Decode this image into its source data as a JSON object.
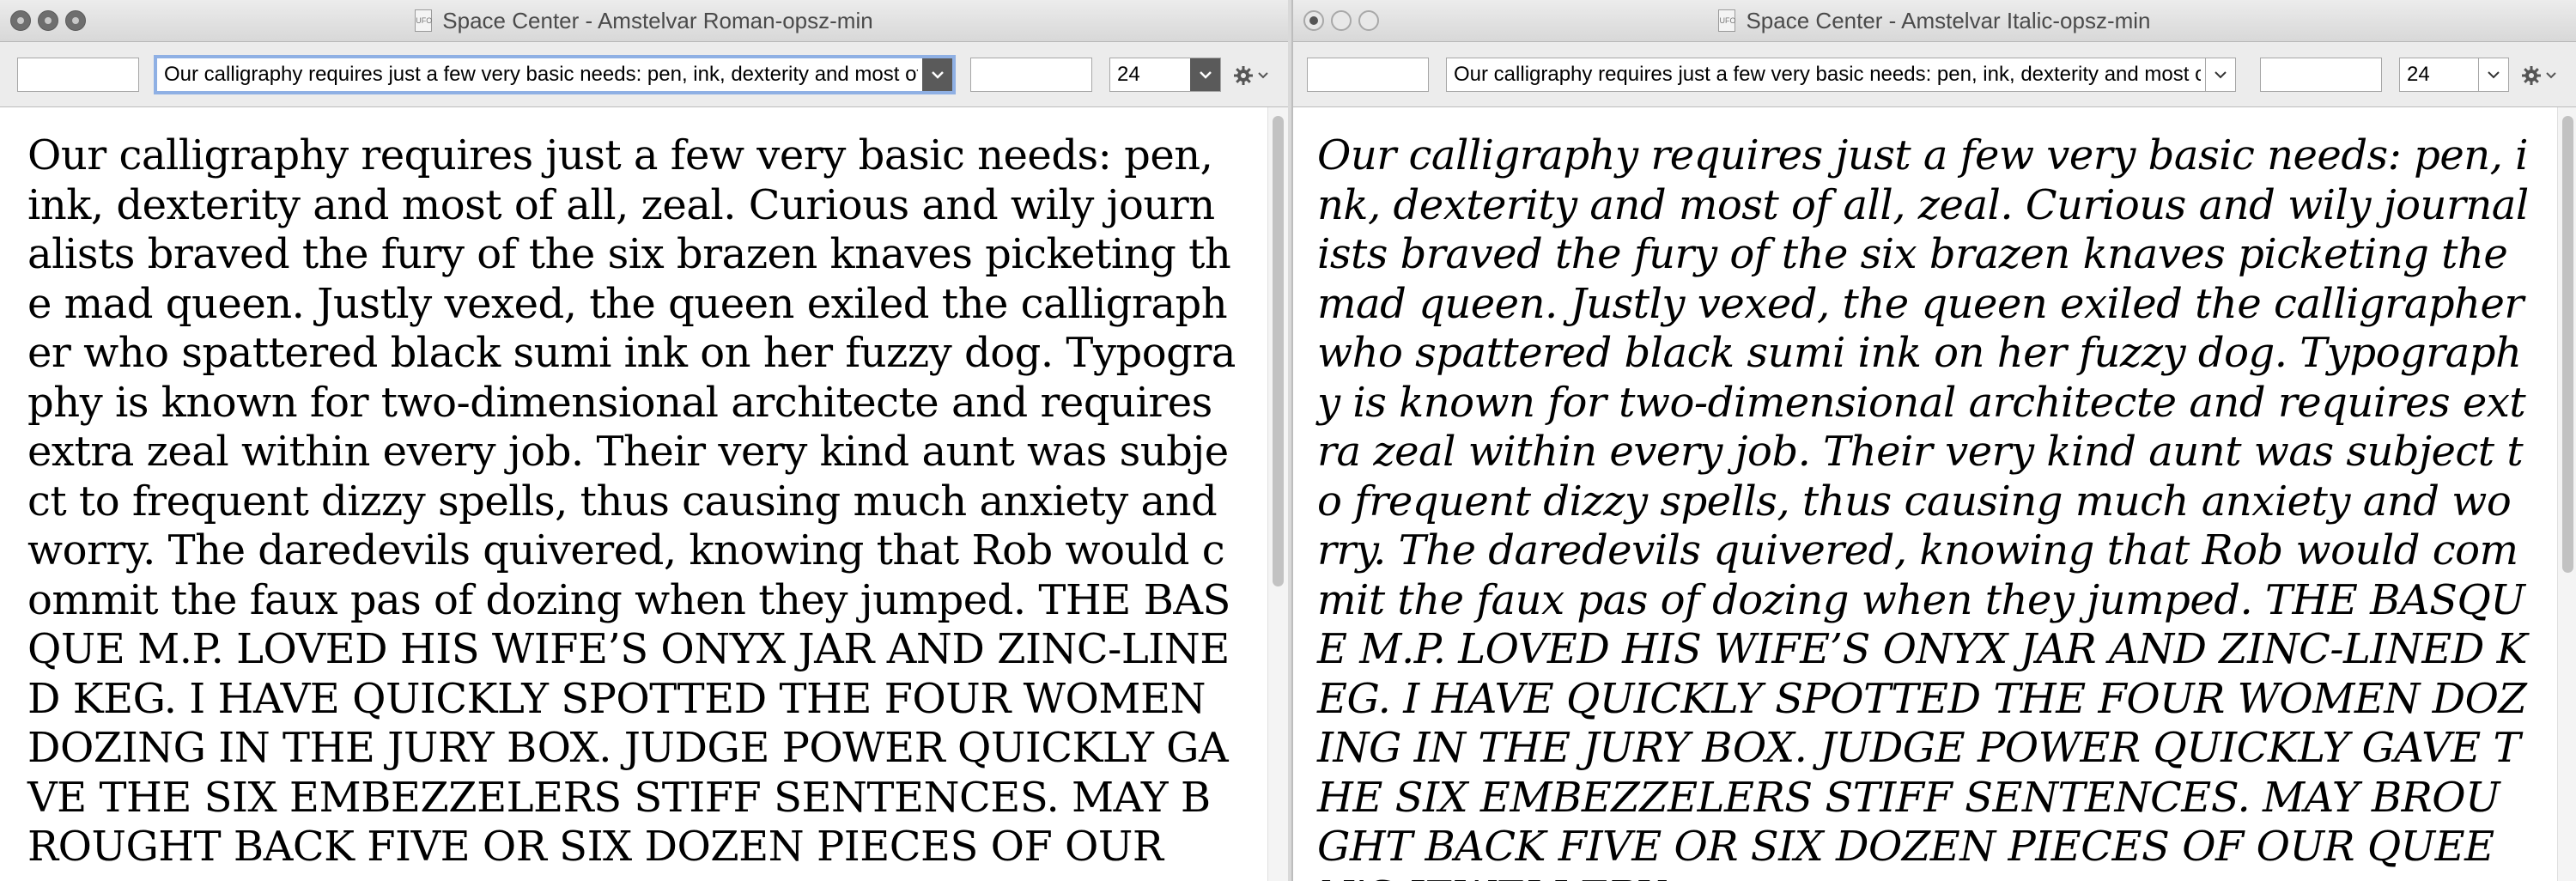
{
  "windows": [
    {
      "title": "Space Center - Amstelvar Roman-opsz-min",
      "doc_icon": "UFO",
      "toolbar": {
        "glyph_field_before": "",
        "sample_text": "Our calligraphy requires just a few very basic needs: pen, ink, dexterity and most of all, zeal.",
        "glyph_field_after": "",
        "point_size": "24"
      },
      "body_text": "Our calligraphy requires just a few very basic needs: pen, ink, dexterity and most of all, zeal. Curious and wily journalists braved the fury of the six brazen knaves picketing the mad queen. Justly vexed, the queen exiled the calligrapher who spattered black sumi ink on her fuzzy dog. Typography is known for two-dimensional architecte and requires extra zeal within every job. Their very kind aunt was subject to frequent dizzy spells, thus causing much anxiety and worry. The daredevils quivered, knowing that Rob would commit the faux pas of dozing when they jumped. THE BASQUE M.P. LOVED HIS WIFE’S ONYX JAR AND ZINC-LINED KEG. I HAVE QUICKLY SPOTTED THE FOUR WOMEN DOZING IN THE JURY BOX. JUDGE POWER QUICKLY GAVE THE SIX EMBEZZELERS STIFF SENTENCES. MAY BROUGHT BACK FIVE OR SIX DOZEN PIECES OF OUR"
    },
    {
      "title": "Space Center - Amstelvar Italic-opsz-min",
      "doc_icon": "UFO",
      "toolbar": {
        "glyph_field_before": "",
        "sample_text": "Our calligraphy requires just a few very basic needs: pen, ink, dexterity and most of all, zeal.",
        "glyph_field_after": "",
        "point_size": "24"
      },
      "body_text": "Our calligraphy requires just a few very basic needs: pen, ink, dexterity and most of all, zeal. Curious and wily journalists braved the fury of the six brazen knaves picketing the mad queen. Justly vexed, the queen exiled the calligrapher who spattered black sumi ink on her fuzzy dog. Typography is known for two-dimensional architecte and requires extra zeal within every job. Their very kind aunt was subject to frequent dizzy spells, thus causing much anxiety and worry. The daredevils quivered, knowing that Rob would commit the faux pas of dozing when they jumped. THE BASQUE M.P. LOVED HIS WIFE’S ONYX JAR AND ZINC-LINED KEG. I HAVE QUICKLY SPOTTED THE FOUR WOMEN DOZING IN THE JURY BOX. JUDGE POWER QUICKLY GAVE THE SIX EMBEZZELERS STIFF SENTENCES. MAY BROUGHT BACK FIVE OR SIX DOZEN PIECES OF OUR QUEEN’S JEWELLERY."
    }
  ],
  "icons": {
    "close": "close-icon",
    "minimize": "minimize-icon",
    "zoom": "zoom-icon",
    "dropdown": "chevron-down-icon",
    "settings": "gear-icon",
    "document": "ufo-document-icon"
  },
  "colors": {
    "titlebar": "#e4e4e4",
    "toolbar": "#ececec",
    "focus_ring": "#8fb0e4",
    "text": "#000000"
  }
}
